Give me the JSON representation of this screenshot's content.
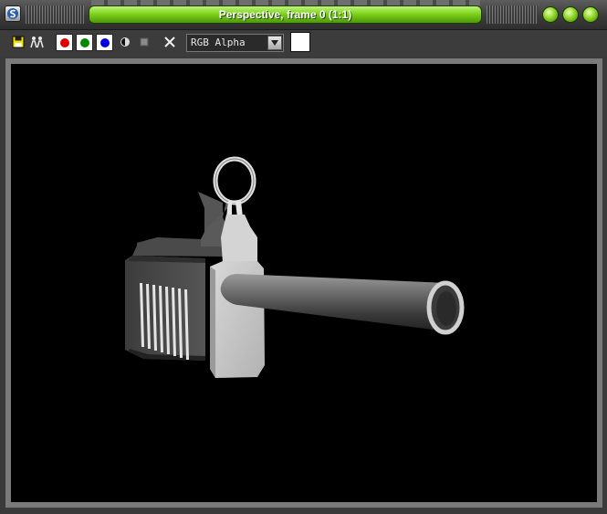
{
  "window": {
    "title": "Perspective, frame 0 (1:1)",
    "accent_color": "#7ed31c"
  },
  "title_buttons": [
    {
      "name": "minimize-button",
      "icon": "green-orb-icon"
    },
    {
      "name": "maximize-button",
      "icon": "green-orb-icon"
    },
    {
      "name": "close-button",
      "icon": "green-orb-icon"
    }
  ],
  "toolbar": {
    "save_icon": "save-icon",
    "clone_icon": "clone-icon",
    "channels": [
      {
        "name": "red-channel",
        "color": "#e00000"
      },
      {
        "name": "green-channel",
        "color": "#008a00"
      },
      {
        "name": "blue-channel",
        "color": "#0000e0"
      }
    ],
    "mono_icon": "monochrome-icon",
    "clear_icon": "clear-icon",
    "channel_display": {
      "selected": "RGB Alpha"
    },
    "background_color": "#ffffff"
  },
  "viewport": {
    "background": "#000000",
    "content": "rendered-gun-model"
  }
}
